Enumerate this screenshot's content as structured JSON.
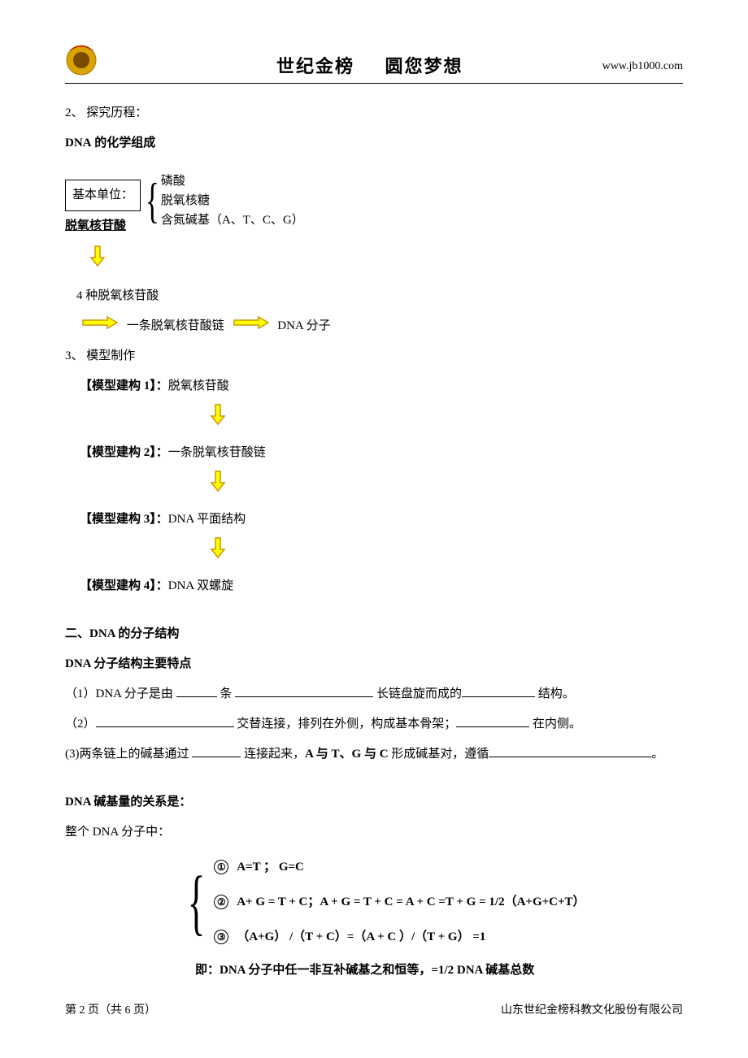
{
  "header": {
    "title": "世纪金榜     圆您梦想",
    "url": "www.jb1000.com"
  },
  "line1": "2、 探究历程：",
  "dna_comp_title": "DNA 的化学组成",
  "basic_unit_label": "基本单位：",
  "brace_items": {
    "a": "磷酸",
    "b": "脱氧核糖",
    "c": "含氮碱基（A、T、C、G）"
  },
  "deoxy_label": "脱氧核苷酸",
  "four_types": "4 种脱氧核苷酸",
  "one_chain": "一条脱氧核苷酸链",
  "dna_mol": "DNA 分子",
  "model_title": "3、 模型制作",
  "build1_label": "【模型建构 1】：",
  "build1_val": "脱氧核苷酸",
  "build2_label": "【模型建构 2】：",
  "build2_val": "一条脱氧核苷酸链",
  "build3_label": "【模型建构 3】：",
  "build3_val": "DNA 平面结构",
  "build4_label": "【模型建构 4】：",
  "build4_val": "DNA 双螺旋",
  "sec2_title": "二、DNA 的分子结构",
  "sec2_sub": "DNA 分子结构主要特点",
  "q1_a": "（1）DNA 分子是由 ",
  "q1_b": " 条 ",
  "q1_c": " 长链盘旋而成的",
  "q1_d": " 结构。",
  "q2_a": "（2）",
  "q2_b": " 交替连接，排列在外侧，构成基本骨架；",
  "q2_c": " 在内侧。",
  "q3_a": "(3)两条链上的碱基通过 ",
  "q3_b": " 连接起来，",
  "q3_c": "A 与 T、G 与 C",
  "q3_d": " 形成碱基对，遵循",
  "q3_e": "。",
  "rel_title": "DNA 碱基量的关系是：",
  "whole_dna": "整个 DNA 分子中：",
  "eq1": "A=T ；  G=C",
  "eq2": "A+ G = T + C；A + G = T + C = A + C =T + G = 1/2（A+G+C+T）",
  "eq3": "（A+G） /（T + C）=（A + C ）/（T + G） =1",
  "eq_note": "即：DNA 分子中任一非互补碱基之和恒等，=1/2   DNA 碱基总数",
  "footer": {
    "left": "第 2 页（共 6 页）",
    "right": "山东世纪金榜科教文化股份有限公司"
  },
  "colors": {
    "arrow_fill": "#ffff00",
    "arrow_stroke": "#cc9900",
    "logo_outer": "#d9a300",
    "logo_inner": "#7a4a00"
  }
}
